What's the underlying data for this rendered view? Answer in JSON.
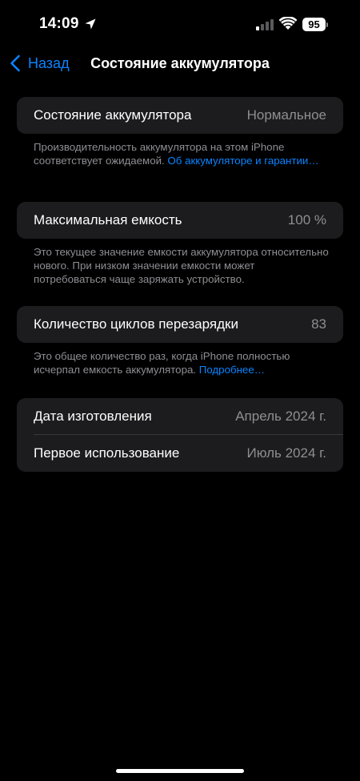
{
  "status_bar": {
    "time": "14:09",
    "battery_level": "95"
  },
  "nav": {
    "back_label": "Назад",
    "title": "Состояние аккумулятора"
  },
  "battery_health": {
    "label": "Состояние аккумулятора",
    "value": "Нормальное",
    "footnote_text": "Производительность аккумулятора на этом iPhone соответствует ожидаемой.",
    "footnote_link": "Об аккумуляторе и гарантии…"
  },
  "max_capacity": {
    "label": "Максимальная емкость",
    "value": "100 %",
    "footnote_text": "Это текущее значение емкости аккумулятора относительно нового. При низком значении емкости может потребоваться чаще заряжать устройство."
  },
  "cycle_count": {
    "label": "Количество циклов перезарядки",
    "value": "83",
    "footnote_text": "Это общее количество раз, когда iPhone полностью исчерпал емкость аккумулятора.",
    "footnote_link": "Подробнее…"
  },
  "dates": {
    "manufacture_label": "Дата изготовления",
    "manufacture_value": "Апрель 2024 г.",
    "first_use_label": "Первое использование",
    "first_use_value": "Июль 2024 г."
  },
  "colors": {
    "accent": "#0a84ff",
    "card_background": "#1c1c1e",
    "secondary_text": "#8e8e93"
  }
}
